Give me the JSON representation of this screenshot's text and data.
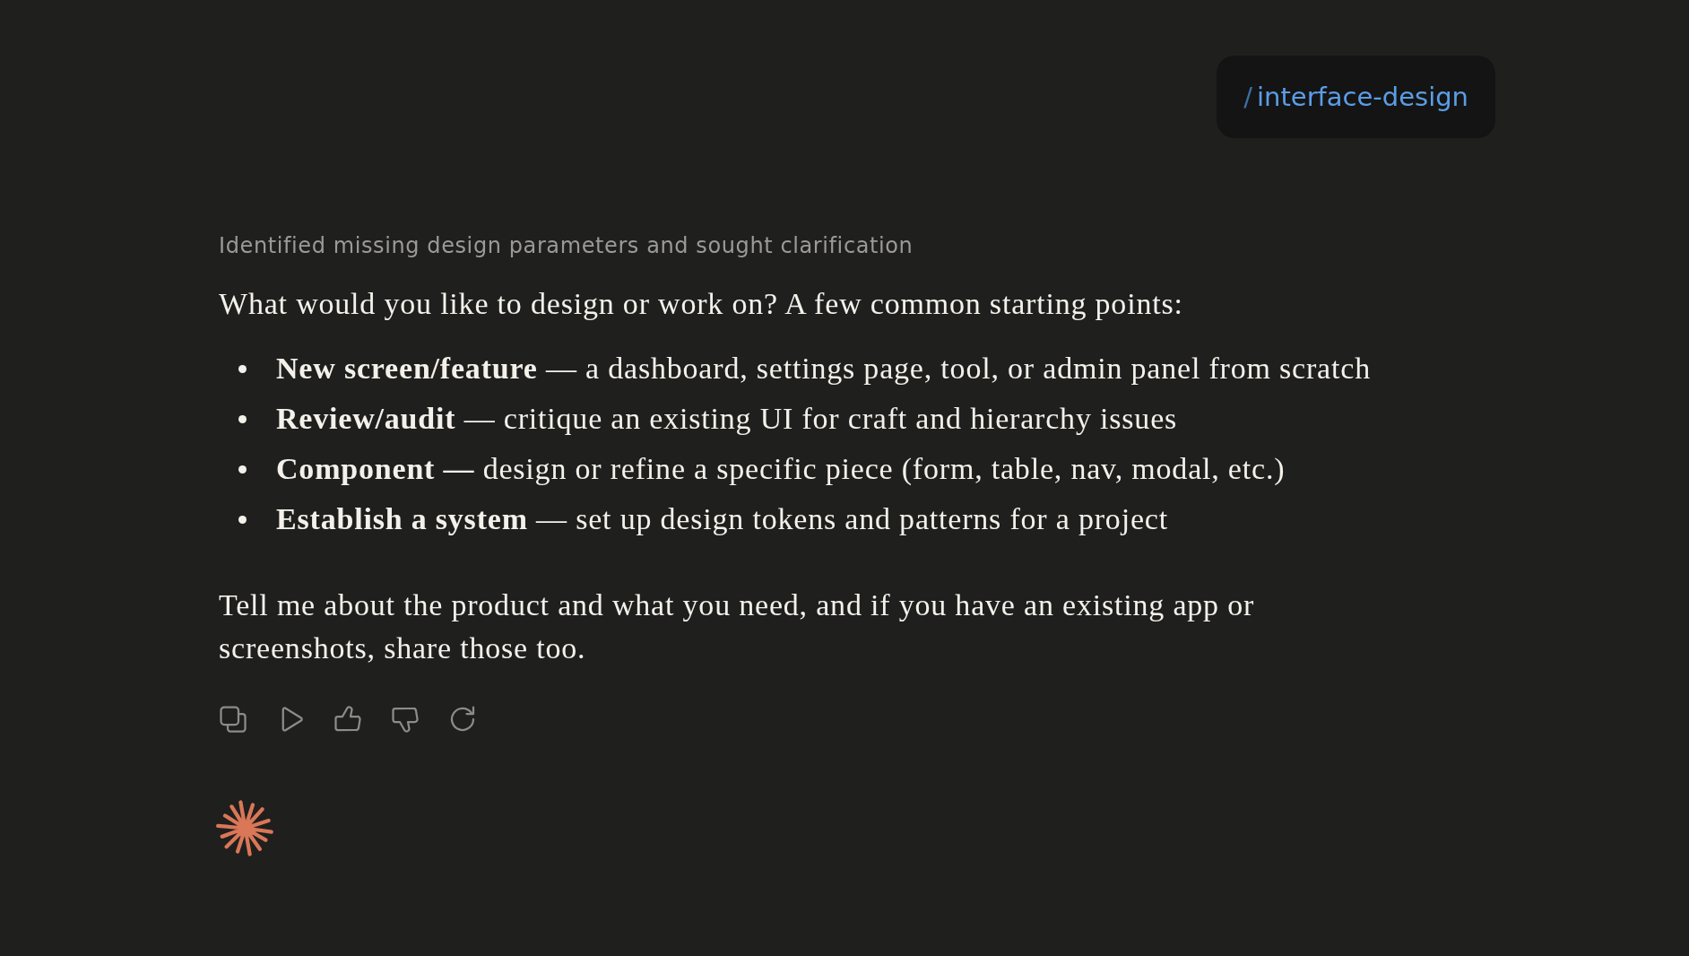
{
  "user_message": {
    "prefix": "/",
    "command": "interface-design"
  },
  "response": {
    "thinking_summary": "Identified missing design parameters and sought clarification",
    "intro": "What would you like to design or work on? A few common starting points:",
    "options": [
      "**New screen/feature** — a dashboard, settings page, tool, or admin panel from scratch",
      "**Review/audit** — critique an existing UI for craft and hierarchy issues",
      "**Component —** design or refine a specific piece (form, table, nav, modal, etc.)",
      "**Establish a system** — set up design tokens and patterns for a project"
    ],
    "closing": "Tell me about the product and what you need, and if you have an existing app or screenshots, share those too."
  }
}
